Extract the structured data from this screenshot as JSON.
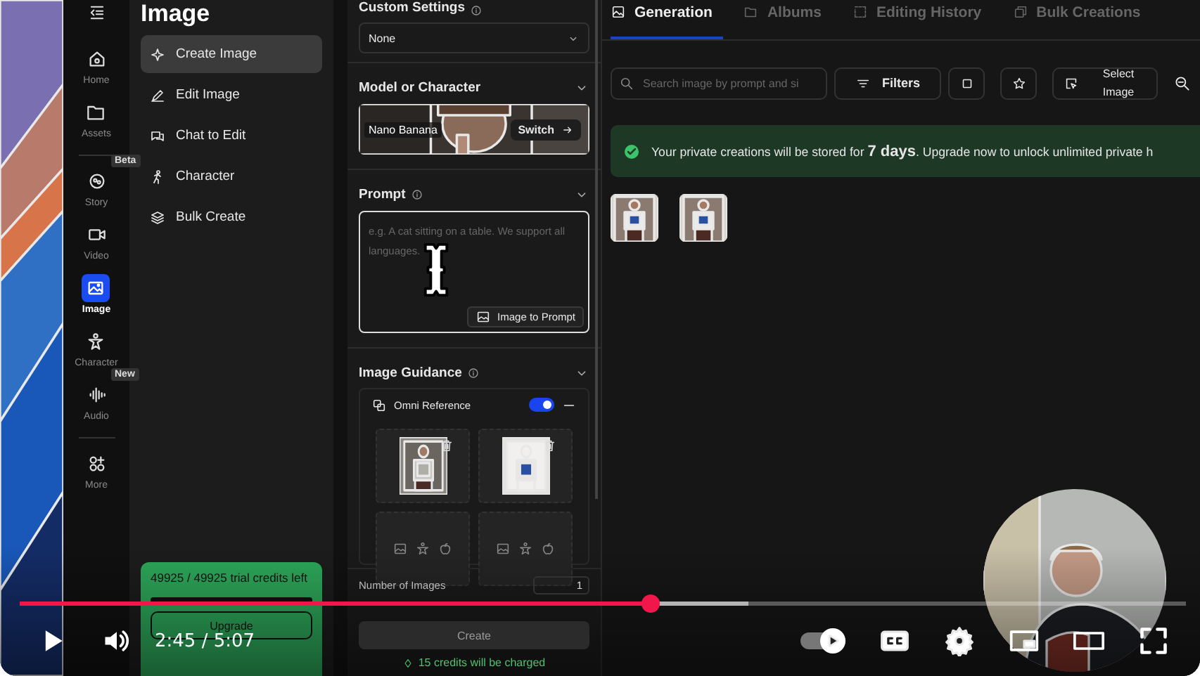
{
  "player": {
    "time": "2:45 / 5:07",
    "progress": {
      "level": 0.54
    },
    "autoplay": {
      "on": true
    }
  },
  "rail": {
    "items": [
      {
        "label": "Home",
        "selected": false
      },
      {
        "label": "Assets",
        "selected": false
      },
      {
        "label": "Story",
        "selected": false,
        "badge": "Beta"
      },
      {
        "label": "Video",
        "selected": false
      },
      {
        "label": "Image",
        "selected": true
      },
      {
        "label": "Character",
        "selected": false
      },
      {
        "label": "Audio",
        "selected": false,
        "badge": "New"
      },
      {
        "label": "More",
        "selected": false
      }
    ]
  },
  "nav": {
    "title": "Image",
    "items": [
      {
        "label": "Create Image",
        "selected": true
      },
      {
        "label": "Edit Image",
        "selected": false
      },
      {
        "label": "Chat to Edit",
        "selected": false
      },
      {
        "label": "Character",
        "selected": false
      },
      {
        "label": "Bulk Create",
        "selected": false
      }
    ],
    "credits": {
      "text": "49925 / 49925 trial credits left",
      "level": 1,
      "button": "Upgrade"
    }
  },
  "form": {
    "custom_settings": {
      "title": "Custom Settings",
      "value": "None"
    },
    "model": {
      "title": "Model or Character",
      "name": "Nano Banana",
      "button": "Switch"
    },
    "prompt": {
      "title": "Prompt",
      "placeholder": "e.g. A cat sitting on a table. We support all languages.",
      "button": "Image to Prompt"
    },
    "guidance": {
      "title": "Image Guidance",
      "reference": {
        "label": "Omni Reference",
        "on": true
      },
      "slots": [
        {
          "kind": "picture"
        },
        {
          "kind": "picture"
        },
        {
          "kind": "empty"
        },
        {
          "kind": "empty"
        }
      ]
    },
    "count": {
      "label": "Number of Images",
      "value": "1"
    },
    "create": "Create",
    "cost": "15 credits will be charged"
  },
  "content": {
    "tabs": [
      {
        "label": "Generation",
        "selected": true
      },
      {
        "label": "Albums",
        "selected": false
      },
      {
        "label": "Editing History",
        "selected": false
      },
      {
        "label": "Bulk Creations",
        "selected": false
      }
    ],
    "search": {
      "placeholder": "Search image by prompt and si"
    },
    "filters": "Filters",
    "select": "Select Image",
    "notice": "Your private creations will be stored for **7 days**. Upgrade now to unlock unlimited private h",
    "gallery": [
      {
        "kind": "picture"
      },
      {
        "kind": "picture"
      }
    ]
  }
}
